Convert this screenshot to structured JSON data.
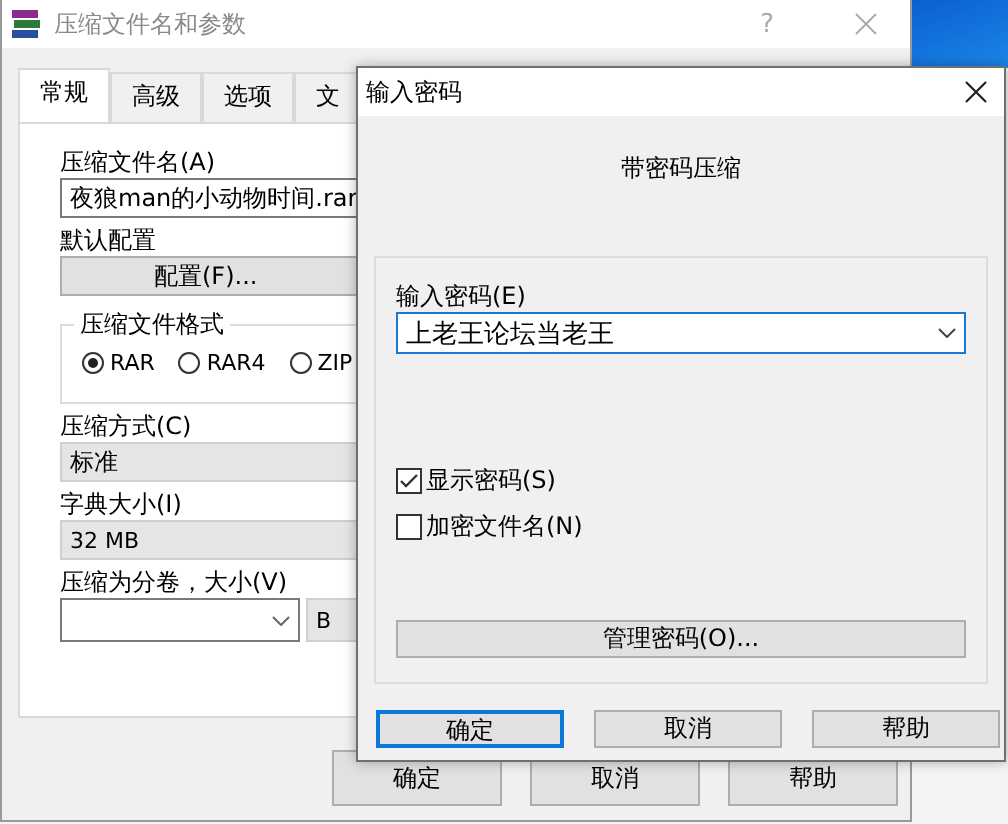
{
  "back_window": {
    "title": "压缩文件名和参数",
    "help": "?",
    "tabs": [
      {
        "label": "常规",
        "selected": true
      },
      {
        "label": "高级",
        "selected": false
      },
      {
        "label": "选项",
        "selected": false
      },
      {
        "label": "文",
        "selected": false
      }
    ],
    "archive_name": {
      "label": "压缩文件名(A)",
      "value": "夜狼man的小动物时间.rar"
    },
    "profile": {
      "label": "默认配置",
      "button": "配置(F)..."
    },
    "format": {
      "title": "压缩文件格式",
      "options": [
        {
          "label": "RAR",
          "selected": true
        },
        {
          "label": "RAR4",
          "selected": false
        },
        {
          "label": "ZIP",
          "selected": false
        }
      ]
    },
    "method": {
      "label": "压缩方式(C)",
      "value": "标准"
    },
    "dictionary": {
      "label": "字典大小(I)",
      "value": "32 MB"
    },
    "volumes": {
      "label": "压缩为分卷，大小(V)",
      "unit": "B"
    },
    "buttons": [
      {
        "label": "确定"
      },
      {
        "label": "取消"
      },
      {
        "label": "帮助"
      }
    ]
  },
  "password_dialog": {
    "title": "输入密码",
    "heading": "带密码压缩",
    "password": {
      "label": "输入密码(E)",
      "value": "上老王论坛当老王"
    },
    "checkboxes": [
      {
        "label": "显示密码(S)",
        "checked": true
      },
      {
        "label": "加密文件名(N)",
        "checked": false
      }
    ],
    "manage_button": "管理密码(O)...",
    "buttons": [
      {
        "label": "确定",
        "focused": true
      },
      {
        "label": "取消",
        "focused": false
      },
      {
        "label": "帮助",
        "focused": false
      }
    ]
  }
}
